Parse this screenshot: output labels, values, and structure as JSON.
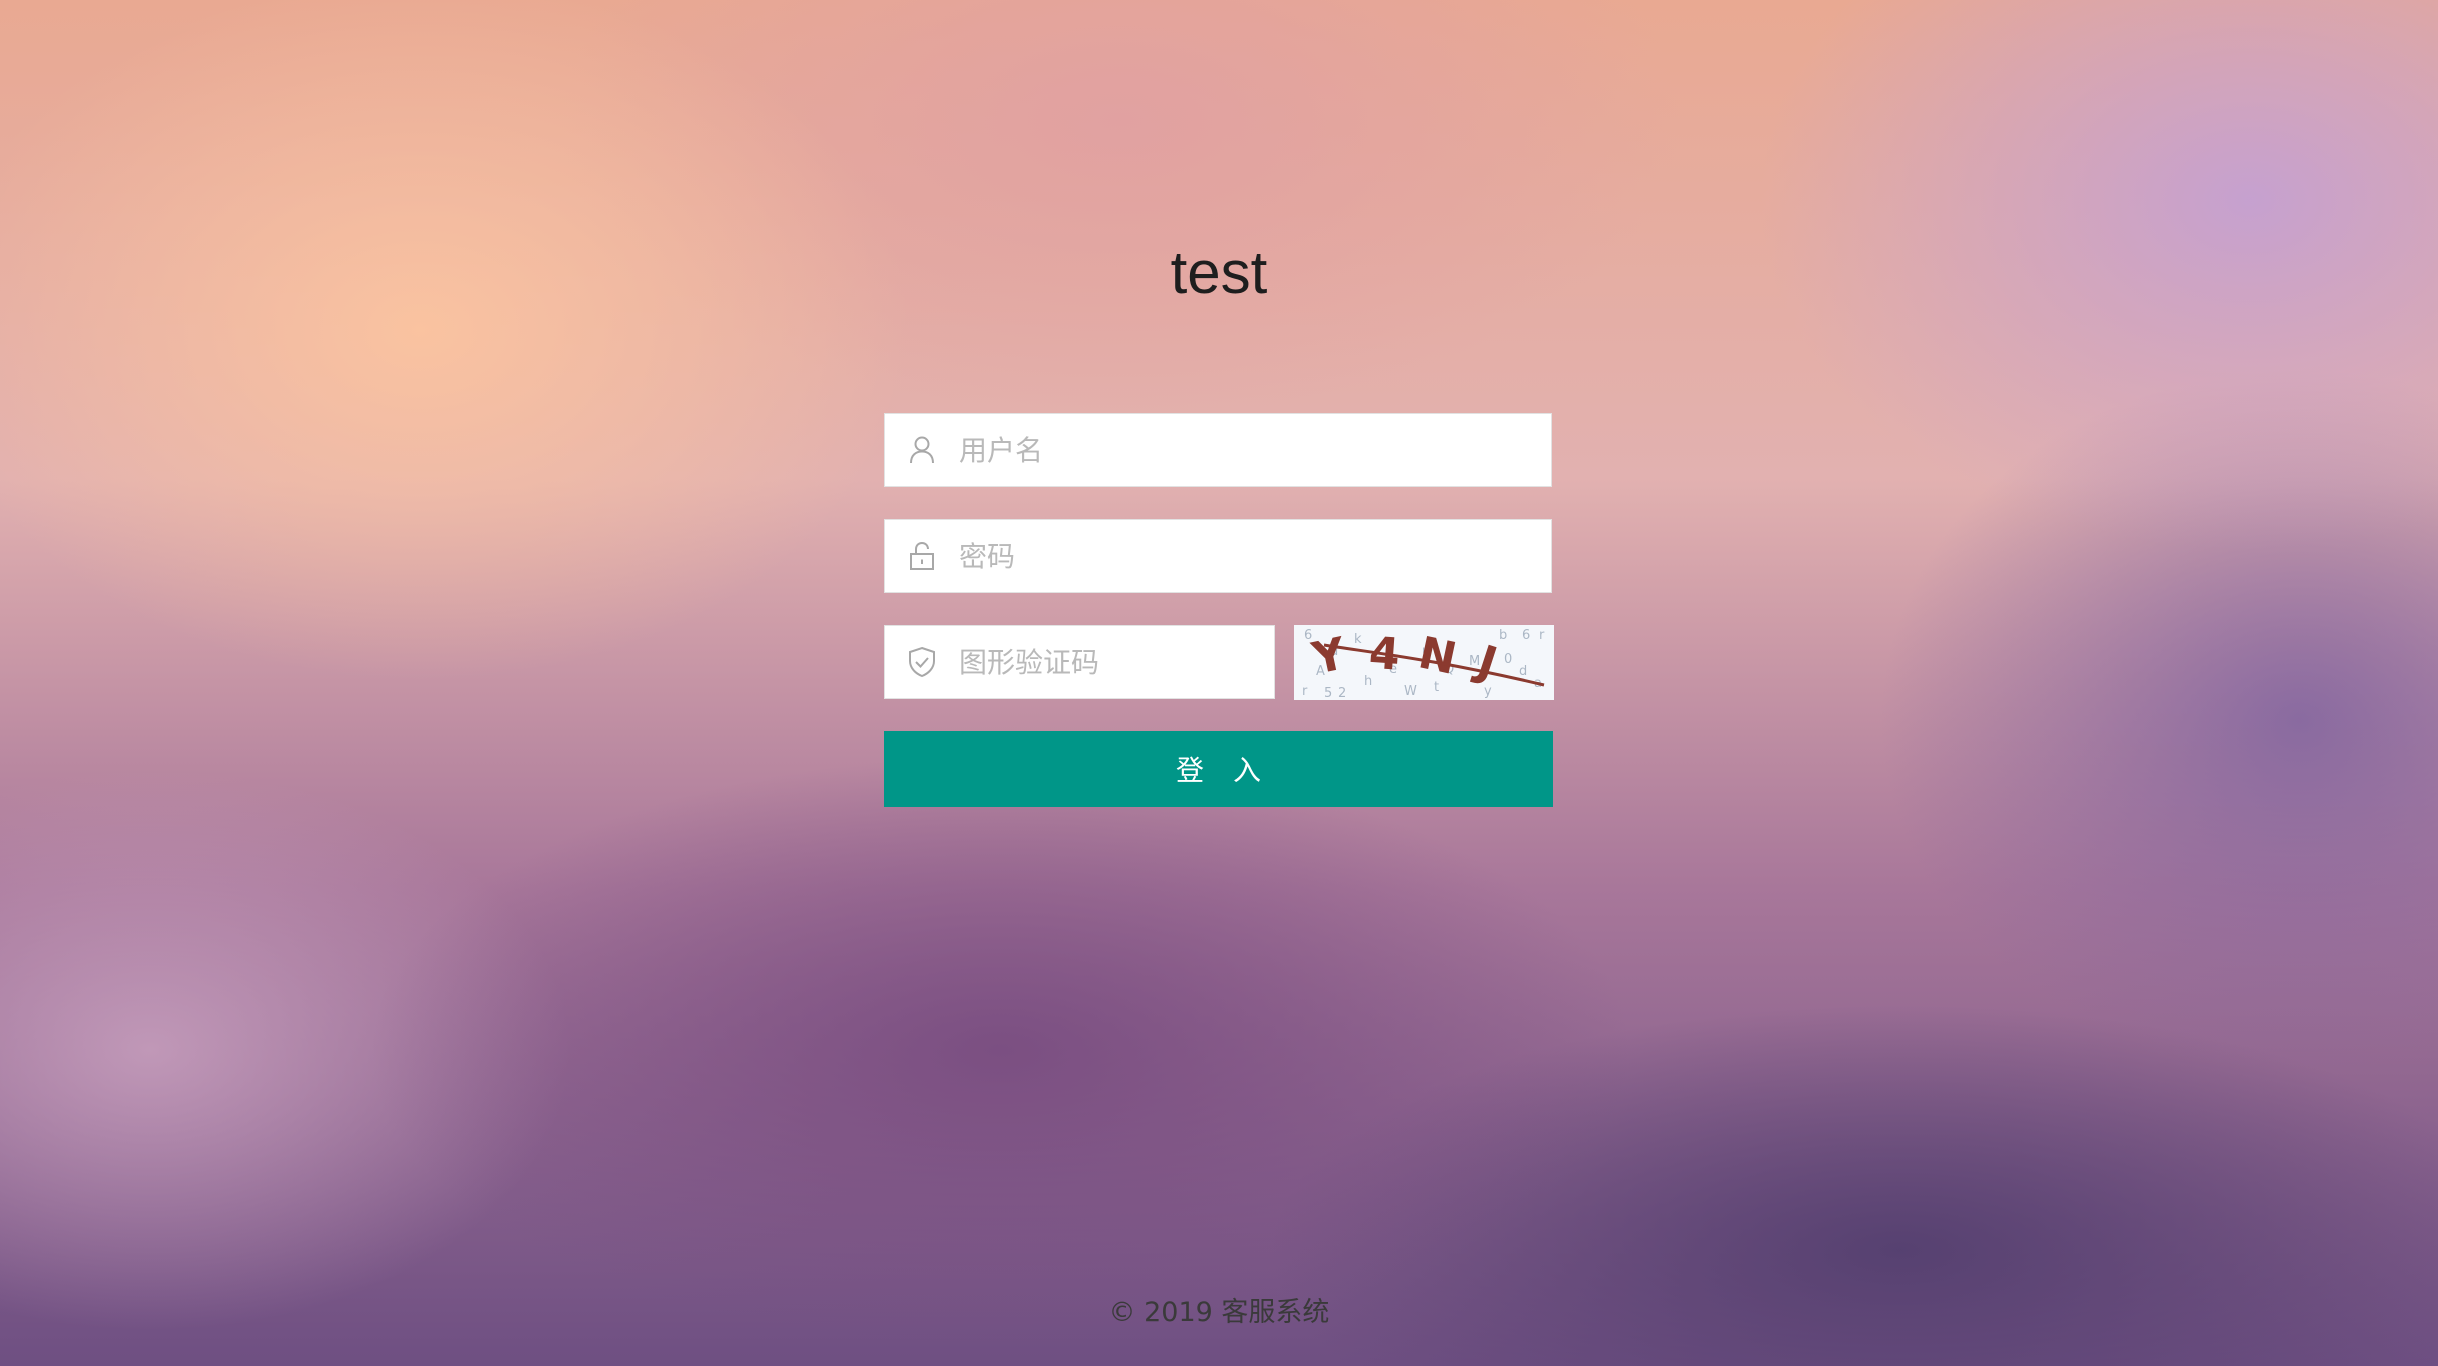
{
  "app_title": "test",
  "form": {
    "username": {
      "placeholder": "用户名",
      "icon": "user-icon"
    },
    "password": {
      "placeholder": "密码",
      "icon": "lock-icon"
    },
    "captcha": {
      "placeholder": "图形验证码",
      "icon": "shield-check-icon",
      "image_text": "Y4NJ"
    },
    "submit_label": "登 入"
  },
  "footer": {
    "copyright": "© 2019 客服系统"
  },
  "colors": {
    "button": "#009688",
    "placeholder": "#b9b9b9",
    "captcha_text": "#8b3a2f"
  }
}
